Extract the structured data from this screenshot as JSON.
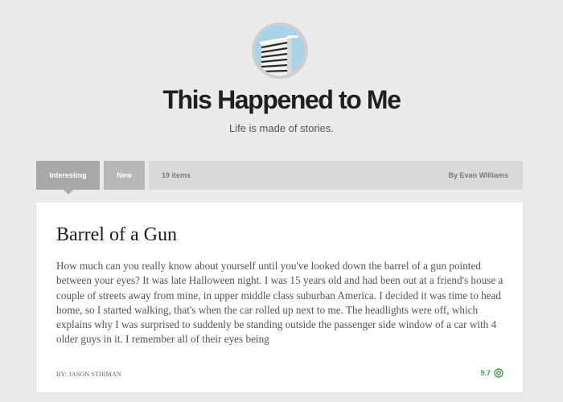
{
  "site": {
    "title": "This Happened to Me",
    "tagline": "Life is made of stories."
  },
  "tabs": [
    {
      "label": "Interesting",
      "active": true
    },
    {
      "label": "New",
      "active": false
    }
  ],
  "info_bar": {
    "count": "19 items",
    "byline": "By Evan Williams"
  },
  "story": {
    "title": "Barrel of a Gun",
    "excerpt": "How much can you really know about yourself until you've looked down the barrel of a gun pointed between your eyes? It was late Halloween night. I was 15 years old and had been out at a friend's house a couple of streets away from mine, in upper middle class suburban America. I decided it was time to head home, so I started walking, that's when the car rolled up next to me. The headlights were off, which explains why I was surprised to suddenly be standing outside the passenger side window of a car with 4 older guys in it. I remember all of their eyes being",
    "author": "BY: JASON STIRMAN",
    "score": "9.7"
  },
  "icons": {
    "logo": "building-logo-icon",
    "score": "score-target-icon"
  },
  "colors": {
    "background": "#ebebeb",
    "tab_active": "#a9a9a9",
    "tab_inactive": "#b8b8b8",
    "info_bar": "#dadada",
    "score": "#4aa04a"
  }
}
